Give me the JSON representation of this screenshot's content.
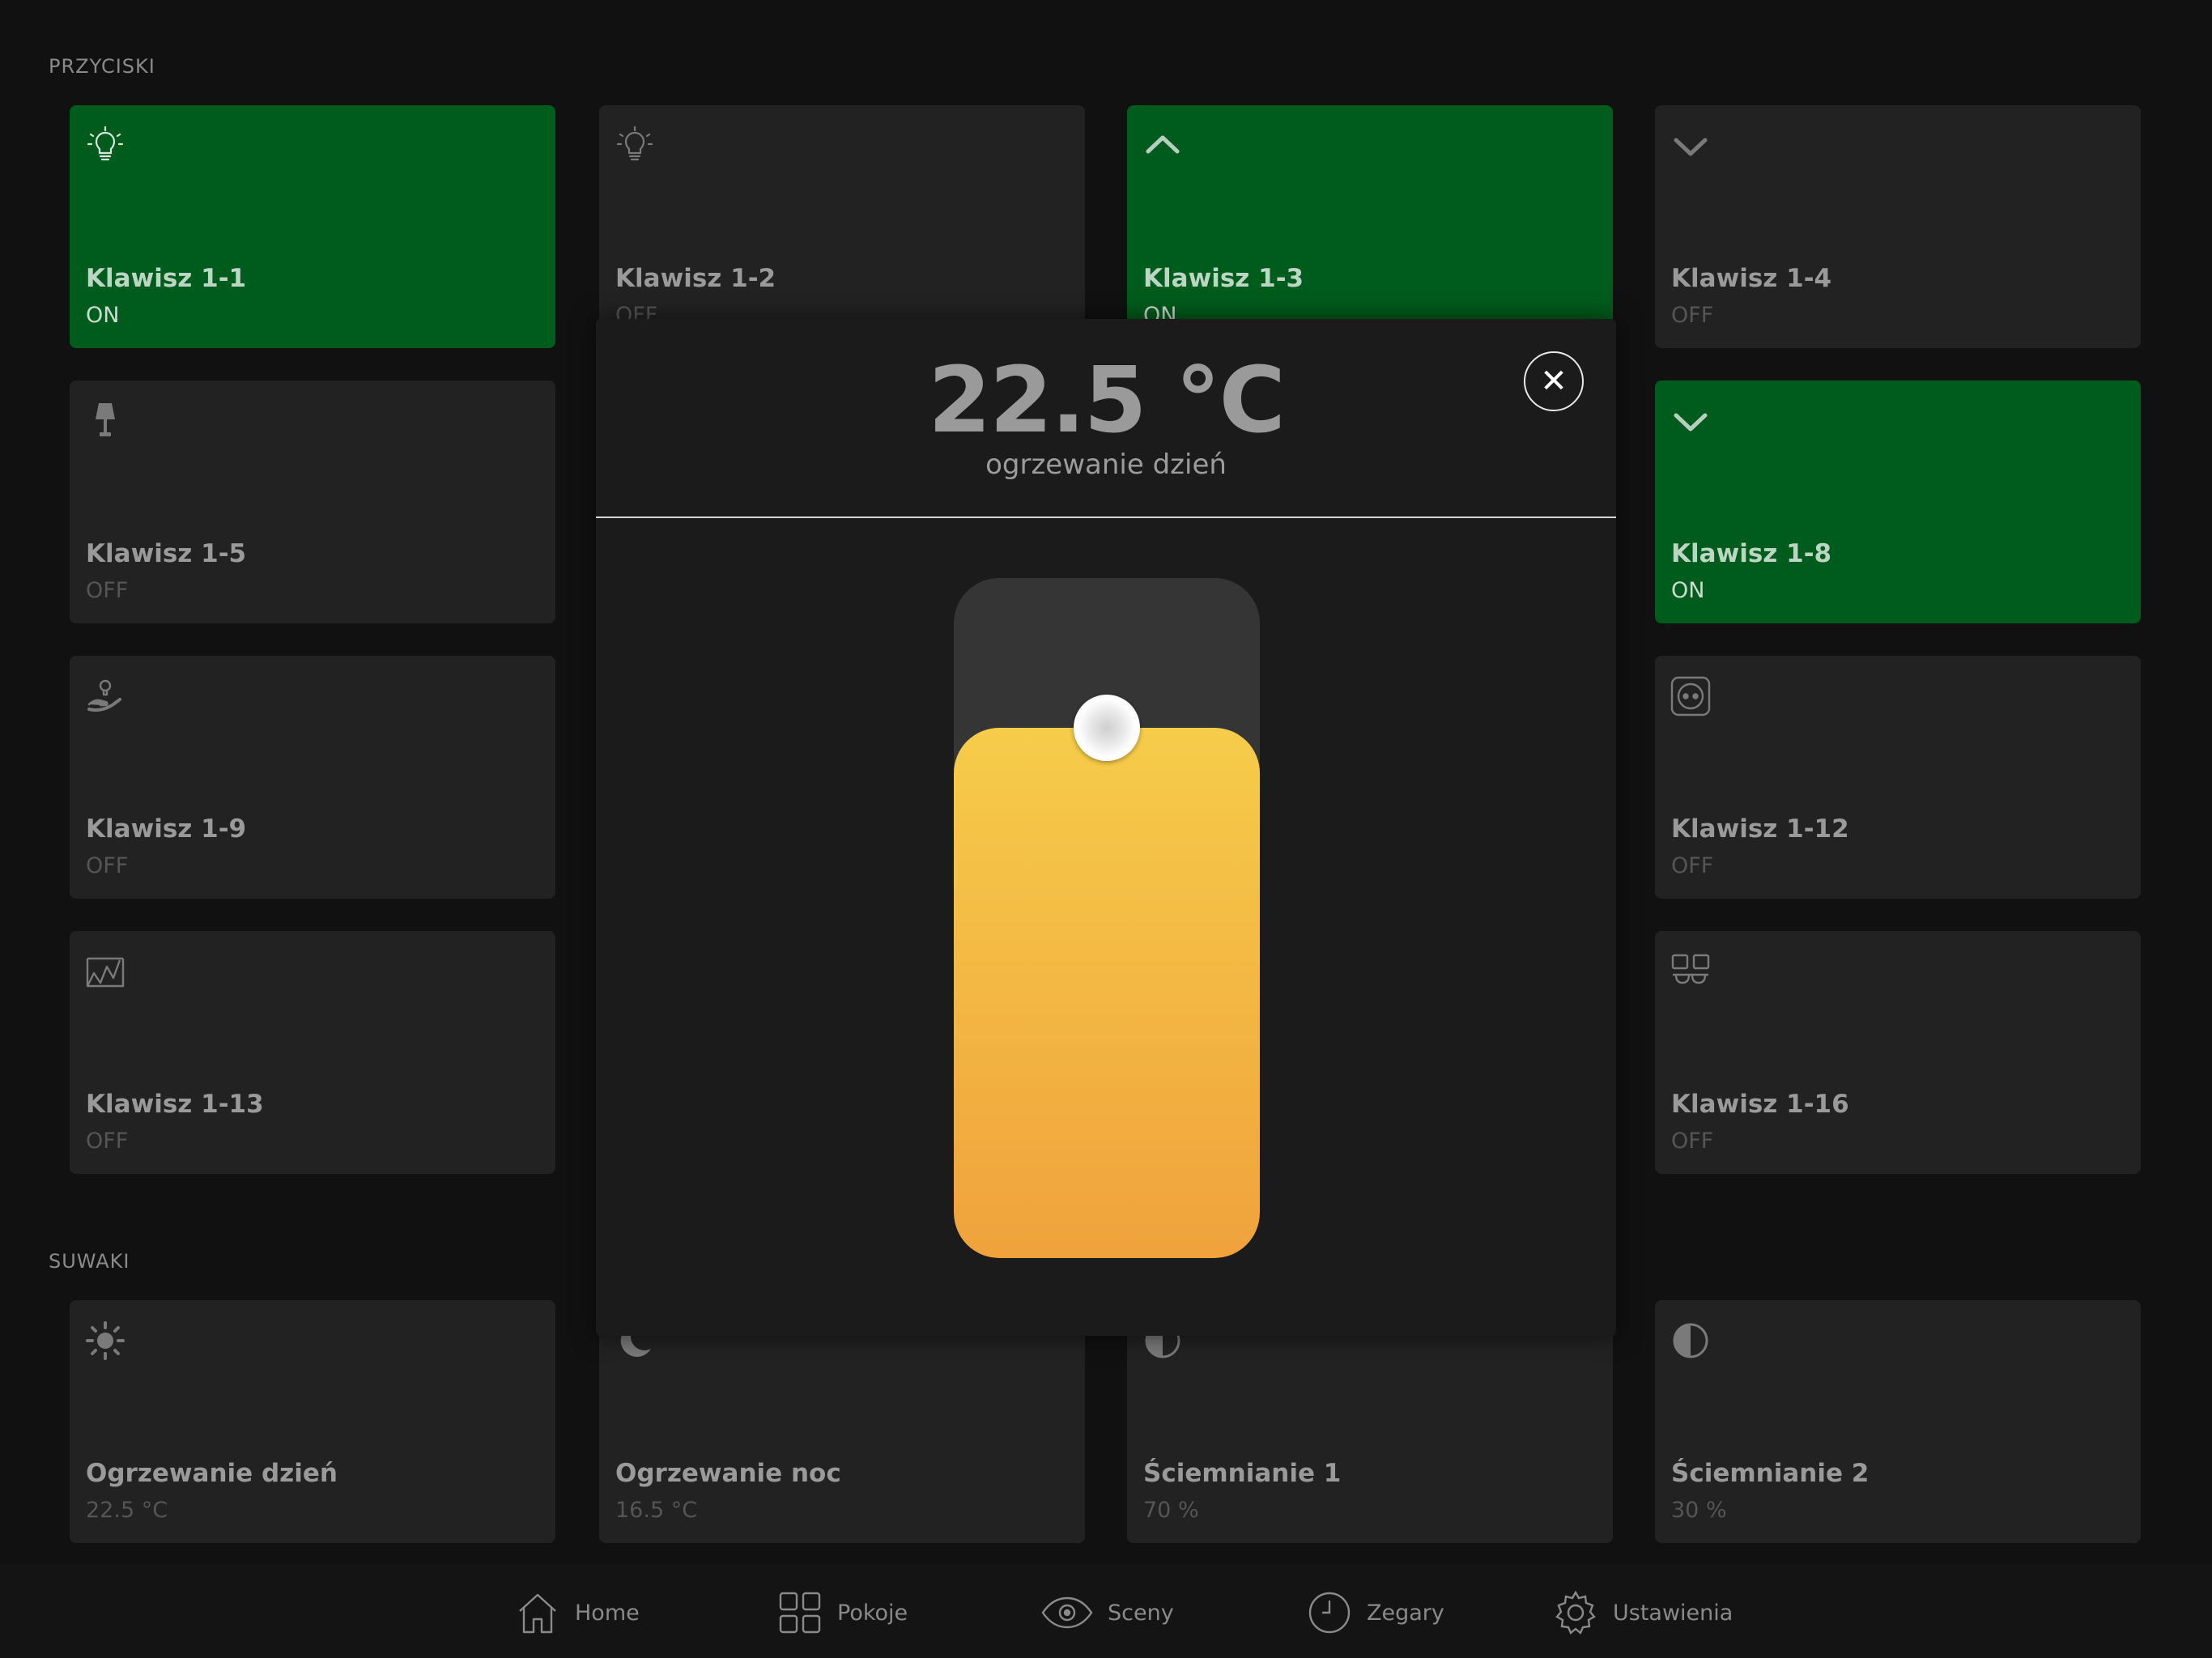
{
  "sections": {
    "buttons_label": "PRZYCISKI",
    "sliders_label": "SUWAKI"
  },
  "tiles": [
    {
      "name": "Klawisz 1-1",
      "state": "ON",
      "icon": "lightbulb-icon"
    },
    {
      "name": "Klawisz 1-2",
      "state": "OFF",
      "icon": "lightbulb-icon"
    },
    {
      "name": "Klawisz 1-3",
      "state": "ON",
      "icon": "chevron-up-icon"
    },
    {
      "name": "Klawisz 1-4",
      "state": "OFF",
      "icon": "chevron-down-icon"
    },
    {
      "name": "Klawisz 1-5",
      "state": "OFF",
      "icon": "lamp-icon"
    },
    {
      "name": "Klawisz 1-8",
      "state": "ON",
      "icon": "chevron-down-icon"
    },
    {
      "name": "Klawisz 1-9",
      "state": "OFF",
      "icon": "hand-bulb-icon"
    },
    {
      "name": "Klawisz 1-12",
      "state": "OFF",
      "icon": "socket-icon"
    },
    {
      "name": "Klawisz 1-13",
      "state": "OFF",
      "icon": "blinds-icon"
    },
    {
      "name": "Klawisz 1-16",
      "state": "OFF",
      "icon": "scene-icon"
    }
  ],
  "sliders": [
    {
      "name": "Ogrzewanie dzień",
      "value": "22.5 °C",
      "icon": "sun-icon"
    },
    {
      "name": "Ogrzewanie noc",
      "value": "16.5 °C",
      "icon": "moon-icon"
    },
    {
      "name": "Ściemnianie 1",
      "value": "70 %",
      "icon": "half-circle-icon"
    },
    {
      "name": "Ściemnianie 2",
      "value": "30 %",
      "icon": "half-circle-icon"
    }
  ],
  "modal": {
    "value": "22.5 °C",
    "subtitle": "ogrzewanie dzień",
    "close_label": "✕",
    "fill_fraction": 0.78
  },
  "nav": {
    "home": "Home",
    "rooms": "Pokoje",
    "scenes": "Sceny",
    "clocks": "Zegary",
    "settings": "Ustawienia"
  },
  "colors": {
    "on": "#005c1c",
    "off": "#222222",
    "accent_fill_top": "#f6cc4a",
    "accent_fill_bottom": "#f0a23c"
  }
}
